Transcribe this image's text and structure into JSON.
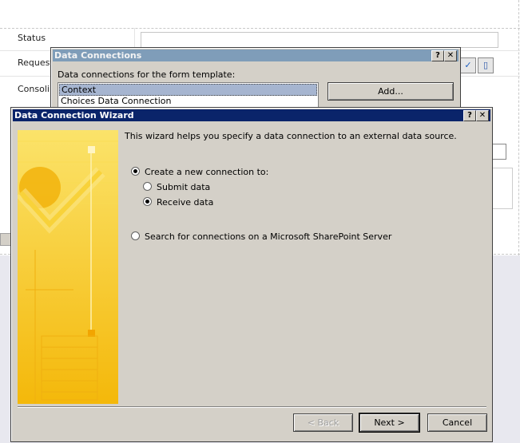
{
  "form": {
    "labels": [
      "Status",
      "Request",
      "Consoli"
    ]
  },
  "data_connections_dialog": {
    "title": "Data Connections",
    "caption": "Data connections for the form template:",
    "items": [
      "Context",
      "Choices Data Connection"
    ],
    "add_label": "Add...",
    "help_label": "?",
    "close_label": "✕"
  },
  "wizard": {
    "title": "Data Connection Wizard",
    "help_label": "?",
    "close_label": "✕",
    "description": "This wizard helps you specify a data connection to an external data source.",
    "option_create": "Create a new connection to:",
    "option_submit": "Submit data",
    "option_receive": "Receive data",
    "option_search": "Search for connections on a Microsoft SharePoint Server",
    "back_label": "< Back",
    "next_label": "Next >",
    "cancel_label": "Cancel"
  },
  "colors": {
    "wizard_titlebar": "#0a246a",
    "inactive_titlebar": "#7f9db9",
    "dialog_face": "#d4d0c8",
    "art_yellow": "#f6c414"
  }
}
